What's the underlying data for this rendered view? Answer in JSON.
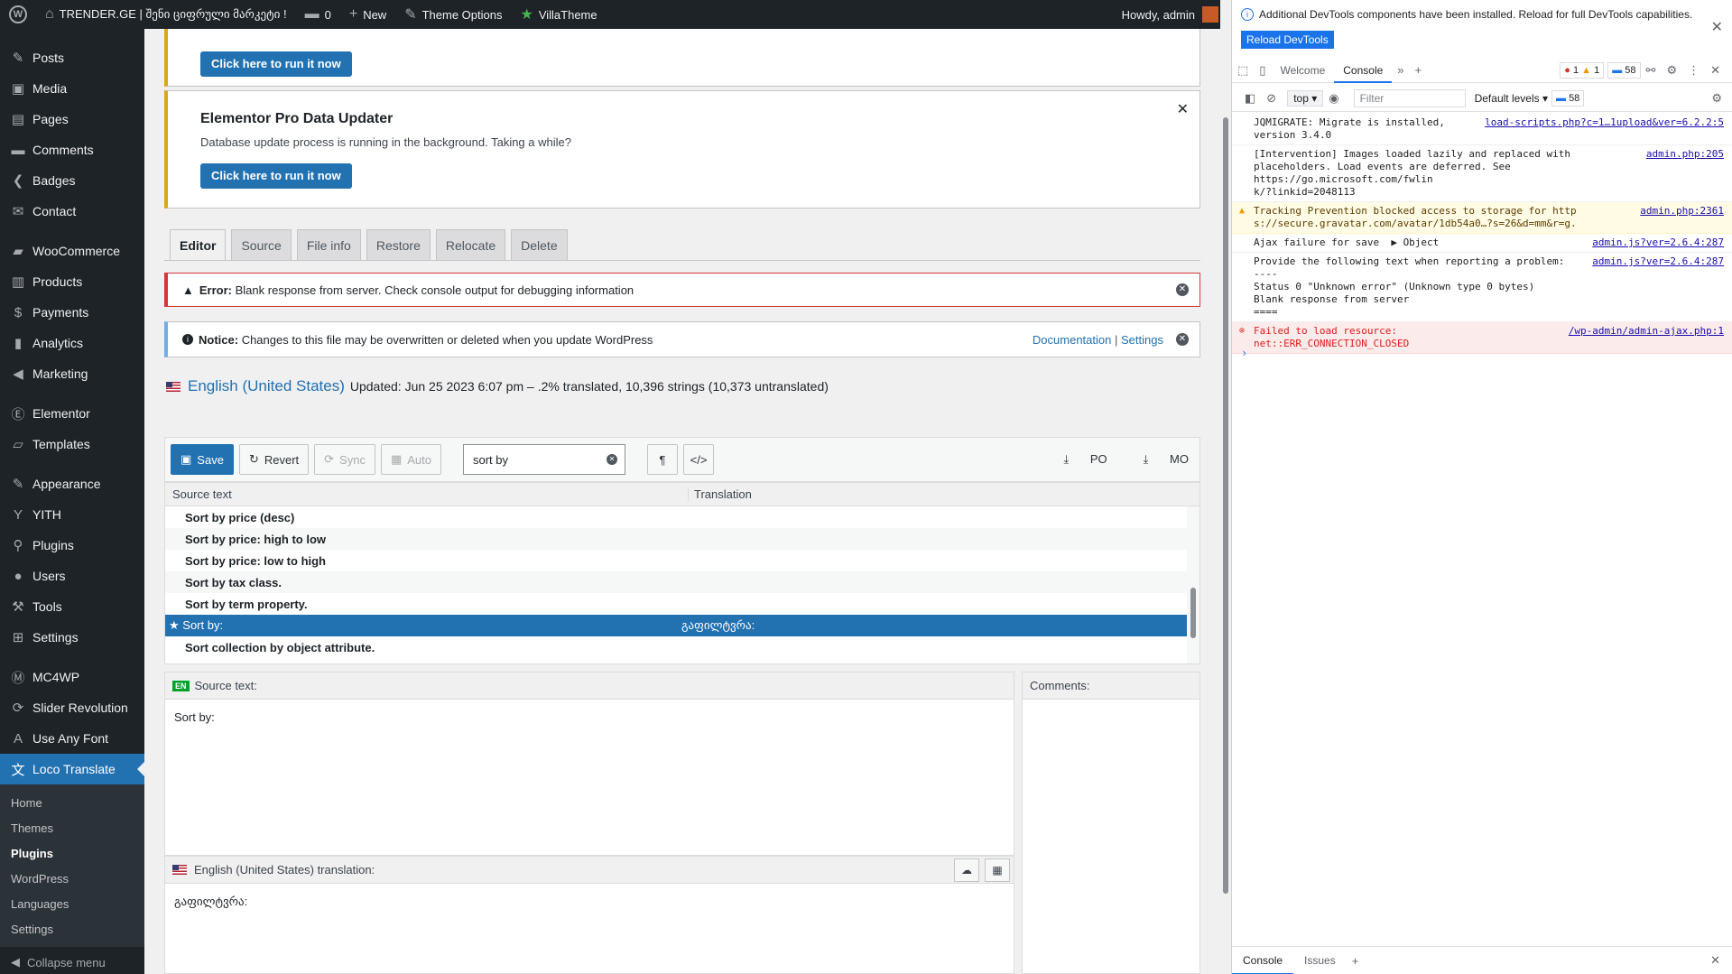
{
  "adminbar": {
    "site_name": "TRENDER.GE | შენი ციფრული მარკეტი !",
    "comments_count": "0",
    "new_label": "New",
    "theme_options_label": "Theme Options",
    "villatheme_label": "VillaTheme",
    "howdy": "Howdy, admin"
  },
  "sidebar": {
    "items": [
      {
        "label": "Posts",
        "icon": "pin-icon"
      },
      {
        "label": "Media",
        "icon": "media-icon"
      },
      {
        "label": "Pages",
        "icon": "pages-icon"
      },
      {
        "label": "Comments",
        "icon": "comment-icon"
      },
      {
        "label": "Badges",
        "icon": "badge-icon"
      },
      {
        "label": "Contact",
        "icon": "mail-icon"
      },
      {
        "label": "WooCommerce",
        "icon": "woo-icon"
      },
      {
        "label": "Products",
        "icon": "archive-icon"
      },
      {
        "label": "Payments",
        "icon": "dollar-icon"
      },
      {
        "label": "Analytics",
        "icon": "chart-icon"
      },
      {
        "label": "Marketing",
        "icon": "megaphone-icon"
      },
      {
        "label": "Elementor",
        "icon": "elementor-icon"
      },
      {
        "label": "Templates",
        "icon": "folder-icon"
      },
      {
        "label": "Appearance",
        "icon": "brush-icon"
      },
      {
        "label": "YITH",
        "icon": "yith-icon"
      },
      {
        "label": "Plugins",
        "icon": "plugin-icon"
      },
      {
        "label": "Users",
        "icon": "user-icon"
      },
      {
        "label": "Tools",
        "icon": "wrench-icon"
      },
      {
        "label": "Settings",
        "icon": "settings-icon"
      },
      {
        "label": "MC4WP",
        "icon": "mc4wp-icon"
      },
      {
        "label": "Slider Revolution",
        "icon": "refresh-icon"
      },
      {
        "label": "Use Any Font",
        "icon": "font-icon"
      },
      {
        "label": "Loco Translate",
        "icon": "translate-icon"
      }
    ],
    "submenu": [
      "Home",
      "Themes",
      "Plugins",
      "WordPress",
      "Languages",
      "Settings"
    ],
    "collapse": "Collapse menu"
  },
  "notices": {
    "run_button": "Click here to run it now",
    "pro_title": "Elementor Pro Data Updater",
    "pro_text": "Database update process is running in the background. Taking a while?",
    "run_button_2": "Click here to run it now"
  },
  "tabs": [
    "Editor",
    "Source",
    "File info",
    "Restore",
    "Relocate",
    "Delete"
  ],
  "error_alert": {
    "strong": "Error:",
    "text": "Blank response from server. Check console output for debugging information"
  },
  "info_alert": {
    "strong": "Notice:",
    "text": "Changes to this file may be overwritten or deleted when you update WordPress",
    "doc_link": "Documentation",
    "sep": "|",
    "settings_link": "Settings"
  },
  "header": {
    "language": "English (United States)",
    "status": "Updated: Jun 25 2023 6:07 pm – .2% translated, 10,396 strings (10,373 untranslated)"
  },
  "toolbar": {
    "save": "Save",
    "revert": "Revert",
    "sync": "Sync",
    "auto": "Auto",
    "search_value": "sort by",
    "po": "PO",
    "mo": "MO"
  },
  "grid": {
    "col_source": "Source text",
    "col_translation": "Translation",
    "rows": [
      {
        "source": "Sort by price (desc)",
        "translation": ""
      },
      {
        "source": "Sort by price: high to low",
        "translation": ""
      },
      {
        "source": "Sort by price: low to high",
        "translation": ""
      },
      {
        "source": "Sort by tax class.",
        "translation": ""
      },
      {
        "source": "Sort by term property.",
        "translation": ""
      },
      {
        "source": "Sort by:",
        "translation": "გაფილტვრა:"
      },
      {
        "source": "Sort collection by object attribute.",
        "translation": ""
      }
    ]
  },
  "source_panel": {
    "badge": "EN",
    "title": "Source text:",
    "text": "Sort by:"
  },
  "comments_panel": {
    "title": "Comments:"
  },
  "translation_panel": {
    "title": "English (United States) translation:",
    "text": "გაფილტვრა:"
  },
  "devtools": {
    "info": "Additional DevTools components have been installed. Reload for full DevTools capabilities.",
    "reload": "Reload DevTools",
    "tabs": [
      "Welcome",
      "Console"
    ],
    "errors": "1",
    "warnings": "1",
    "messages": "58",
    "context": "top",
    "filter_placeholder": "Filter",
    "levels": "Default levels",
    "messages_badge": "58",
    "console": [
      {
        "type": "log",
        "text": "JQMIGRATE: Migrate is installed,\nversion 3.4.0",
        "src": "load-scripts.php?c=1…1upload&ver=6.2.2:5"
      },
      {
        "type": "log",
        "text": "[Intervention] Images loaded lazily and replaced with\nplaceholders. Load events are deferred. See https://go.microsoft.com/fwlin\nk/?linkid=2048113",
        "src": "admin.php:205"
      },
      {
        "type": "warn",
        "text": "Tracking Prevention blocked access to storage for http\ns://secure.gravatar.com/avatar/1db54a0…?s=26&d=mm&r=g.",
        "src": "admin.php:2361"
      },
      {
        "type": "log",
        "text": "Ajax failure for save  ▶ Object",
        "src": "admin.js?ver=2.6.4:287"
      },
      {
        "type": "log",
        "text": "Provide the following text when reporting a problem:\n----\nStatus 0 \"Unknown error\" (Unknown type 0 bytes)\nBlank response from server\n====",
        "src": "admin.js?ver=2.6.4:287"
      },
      {
        "type": "err",
        "text": "Failed to load resource:\nnet::ERR_CONNECTION_CLOSED",
        "src": "/wp-admin/admin-ajax.php:1"
      }
    ],
    "bottom_tabs": [
      "Console",
      "Issues"
    ]
  }
}
